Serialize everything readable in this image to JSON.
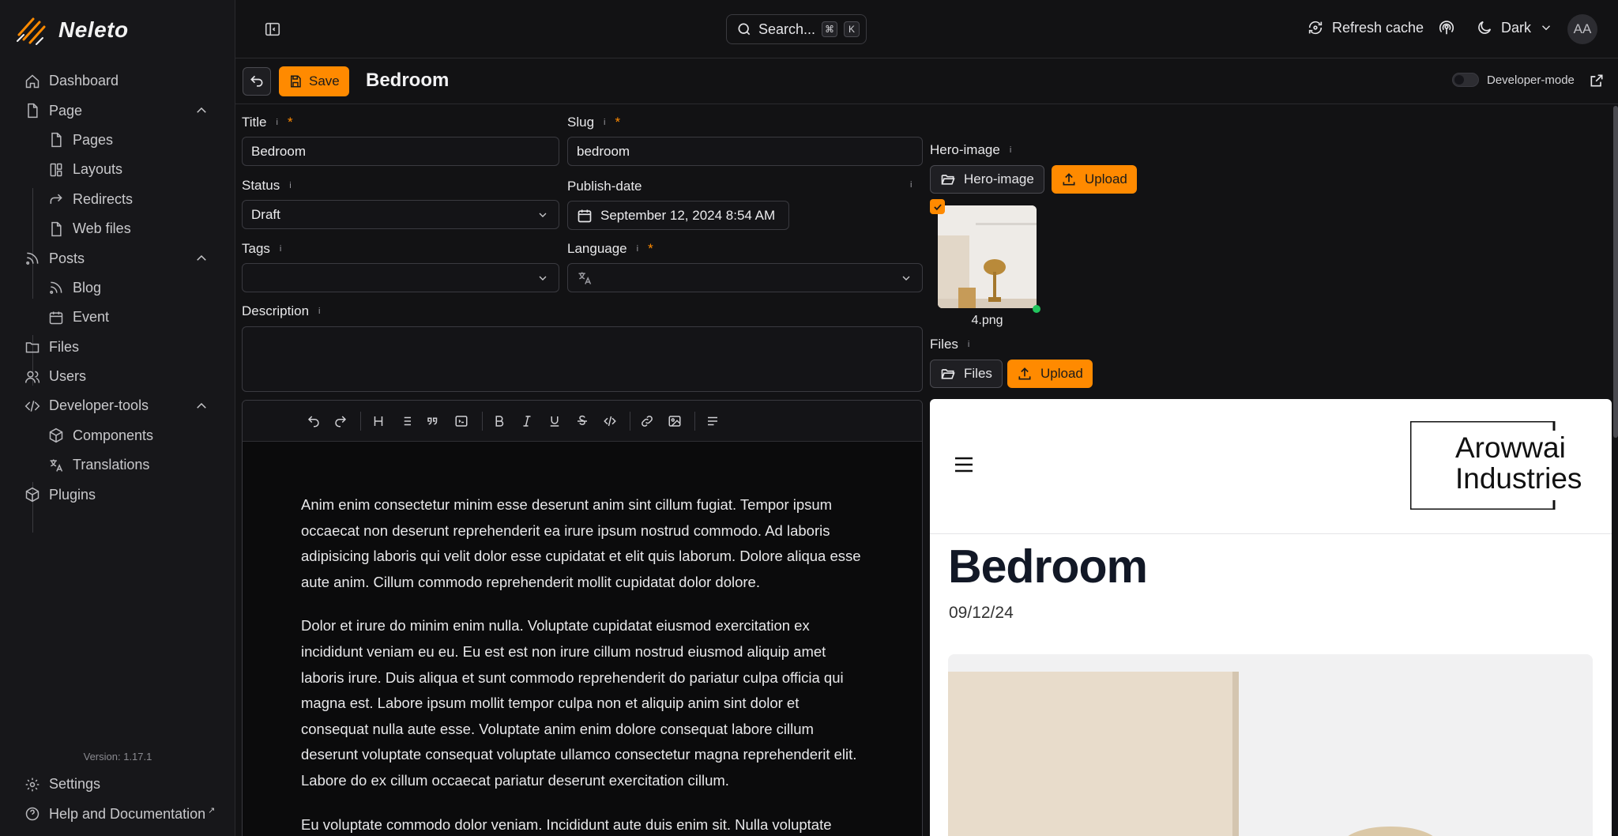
{
  "app": {
    "name": "Neleto",
    "version": "Version: 1.17.1"
  },
  "colors": {
    "accent": "#ff8a00",
    "background": "#121214",
    "sidebar": "#17171a",
    "online": "#22c55e"
  },
  "sidebar": {
    "items": [
      {
        "label": "Dashboard",
        "icon": "home-icon"
      },
      {
        "label": "Page",
        "icon": "file-icon"
      },
      {
        "label": "Pages",
        "icon": "file-icon"
      },
      {
        "label": "Layouts",
        "icon": "layout-icon"
      },
      {
        "label": "Redirects",
        "icon": "redirect-icon"
      },
      {
        "label": "Web files",
        "icon": "file-icon"
      },
      {
        "label": "Posts",
        "icon": "rss-icon"
      },
      {
        "label": "Blog",
        "icon": "rss-icon"
      },
      {
        "label": "Event",
        "icon": "calendar-icon"
      },
      {
        "label": "Files",
        "icon": "folder-icon"
      },
      {
        "label": "Users",
        "icon": "users-icon"
      },
      {
        "label": "Developer-tools",
        "icon": "code-icon"
      },
      {
        "label": "Components",
        "icon": "box-icon"
      },
      {
        "label": "Translations",
        "icon": "translate-icon"
      },
      {
        "label": "Plugins",
        "icon": "box-icon"
      }
    ],
    "settings": "Settings",
    "help": "Help and Documentation",
    "help_suffix": "↗"
  },
  "topbar": {
    "search_label": "Search...",
    "kbd_cmd": "⌘",
    "kbd_key": "K",
    "refresh_label": "Refresh cache",
    "theme_label": "Dark",
    "avatar_initials": "AA"
  },
  "header": {
    "save_label": "Save",
    "title": "Bedroom",
    "devmode_label": "Developer-mode"
  },
  "form": {
    "title_label": "Title",
    "title_value": "Bedroom",
    "slug_label": "Slug",
    "slug_value": "bedroom",
    "status_label": "Status",
    "status_value": "Draft",
    "publish_label": "Publish-date",
    "publish_value": "September 12, 2024 8:54 AM",
    "tags_label": "Tags",
    "language_label": "Language",
    "description_label": "Description",
    "hero_label": "Hero-image",
    "hero_button": "Hero-image",
    "upload_label": "Upload",
    "file_name": "4.png",
    "files_label": "Files",
    "files_button": "Files",
    "info_mark": "i",
    "required_mark": "*"
  },
  "editor": {
    "paragraphs": [
      "Anim enim consectetur minim esse deserunt anim sint cillum fugiat. Tempor ipsum occaecat non deserunt reprehenderit ea irure ipsum nostrud commodo. Ad laboris adipisicing laboris qui velit dolor esse cupidatat et elit quis laborum. Dolore aliqua esse aute anim. Cillum commodo reprehenderit mollit cupidatat dolor dolore.",
      "Dolor et irure do minim enim nulla. Voluptate cupidatat eiusmod exercitation ex incididunt veniam eu eu. Eu est est non irure cillum nostrud eiusmod aliquip amet laboris irure. Duis aliqua et sunt commodo reprehenderit do pariatur culpa officia qui magna est. Labore ipsum mollit tempor culpa non et aliquip anim sint dolor et consequat nulla aute esse. Voluptate anim enim dolore consequat labore cillum deserunt voluptate consequat voluptate ullamco consectetur magna reprehenderit elit. Labore do ex cillum occaecat pariatur deserunt exercitation cillum.",
      "Eu voluptate commodo dolor veniam. Incididunt aute duis enim sit. Nulla voluptate"
    ]
  },
  "preview": {
    "logo_line1": "Arowwai",
    "logo_line2": "Industries",
    "title": "Bedroom",
    "date": "09/12/24"
  }
}
